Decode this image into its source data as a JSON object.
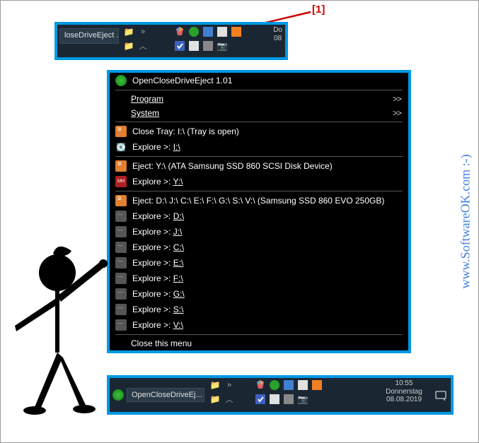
{
  "callout": {
    "label": "[1]"
  },
  "taskbar_top": {
    "task": "loseDriveEject ...",
    "date_hint": "Do\n08"
  },
  "menu": {
    "title": "OpenCloseDriveEject 1.01",
    "program": "Program",
    "system": "System",
    "close_tray": "Close Tray: I:\\ (Tray is open)",
    "explore_i": "Explore >:",
    "drive_i": "I:\\",
    "eject_y": "Eject: Y:\\  (ATA Samsung SSD 860 SCSI Disk Device)",
    "explore_y": "Explore >:",
    "drive_y": "Y:\\",
    "eject_multi": "Eject: D:\\ J:\\ C:\\ E:\\ F:\\ G:\\ S:\\ V:\\  (Samsung SSD 860 EVO 250GB)",
    "explore": "Explore >:",
    "drives": {
      "d": "D:\\",
      "j": "J:\\",
      "c": "C:\\",
      "e": "E:\\",
      "f": "F:\\",
      "g": "G:\\",
      "s": "S:\\",
      "v": "V:\\"
    },
    "close_menu": "Close this menu"
  },
  "taskbar_bottom": {
    "task": "OpenCloseDriveEj...",
    "time": "10:55",
    "day": "Donnerstag",
    "date": "08.08.2019"
  },
  "watermark": "www.SoftwareOK.com :-)"
}
